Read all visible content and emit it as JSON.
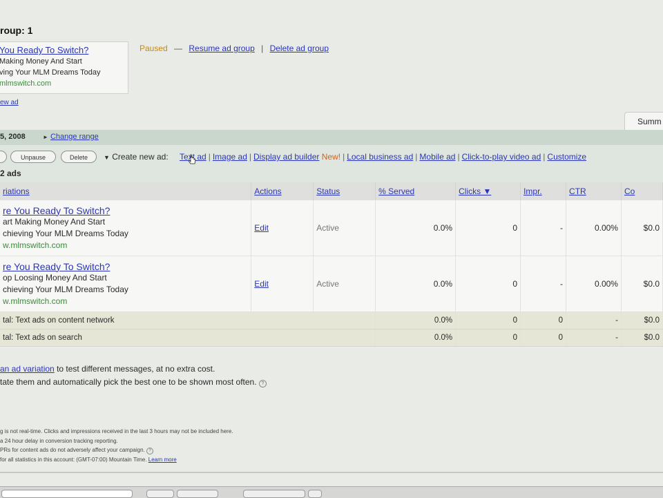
{
  "header": {
    "ad_group_title": "roup: 1",
    "preview": {
      "headline": "You Ready To Switch?",
      "line1": "Making Money And Start",
      "line2": "ving Your MLM Dreams Today",
      "url": "mlmswitch.com",
      "view_link": "ew ad"
    },
    "status": "Paused",
    "dash": "—",
    "resume_link": "Resume ad group",
    "pipe": "|",
    "delete_link": "Delete ad group"
  },
  "tabs": {
    "summary": "Summ"
  },
  "date_band": {
    "date": "5, 2008",
    "change_range": "Change range"
  },
  "toolbar": {
    "buttons": [
      {
        "label": "Unpause"
      },
      {
        "label": "Delete"
      }
    ],
    "create_new_ad": "Create new ad:",
    "ad_types": [
      "Text ad",
      "Image ad",
      "Display ad builder",
      "Local business ad",
      "Mobile ad",
      "Click-to-play video ad",
      "Customize"
    ],
    "new_badge": "New!",
    "count": "2 ads"
  },
  "table": {
    "headers": [
      "riations",
      "Actions",
      "Status",
      "% Served",
      "Clicks ▼",
      "Impr.",
      "CTR",
      "Co"
    ],
    "rows": [
      {
        "headline": "re You Ready To Switch?",
        "line1": "art Making Money And Start",
        "line2": "chieving Your MLM Dreams Today",
        "url": "w.mlmswitch.com",
        "action": "Edit",
        "status": "Active",
        "served": "0.0%",
        "clicks": "0",
        "impr": "-",
        "ctr": "0.00%",
        "cost": "$0.0"
      },
      {
        "headline": "re You Ready To Switch?",
        "line1": "op Loosing Money And Start",
        "line2": "chieving Your MLM Dreams Today",
        "url": "w.mlmswitch.com",
        "action": "Edit",
        "status": "Active",
        "served": "0.0%",
        "clicks": "0",
        "impr": "-",
        "ctr": "0.00%",
        "cost": "$0.0"
      }
    ],
    "totals": [
      {
        "label": "tal: Text ads on content network",
        "served": "0.0%",
        "clicks": "0",
        "impr": "0",
        "ctr": "-",
        "cost": "$0.0"
      },
      {
        "label": "tal: Text ads on search",
        "served": "0.0%",
        "clicks": "0",
        "impr": "0",
        "ctr": "-",
        "cost": "$0.0"
      }
    ]
  },
  "variation_note": {
    "link": "an ad variation",
    "line1_rest": " to test different messages, at no extra cost.",
    "line2": "tate them and automatically pick the best one to be shown most often."
  },
  "footnotes": {
    "line1": "g is not real-time. Clicks and impressions received in the last 3 hours may not be included here.",
    "line2": "a 24 hour delay in conversion tracking reporting.",
    "line3": "PRs for content ads do not adversely affect your campaign.",
    "line4": "for all statistics in this account: (GMT-07:00) Mountain Time.",
    "learn_more": "Learn more"
  }
}
